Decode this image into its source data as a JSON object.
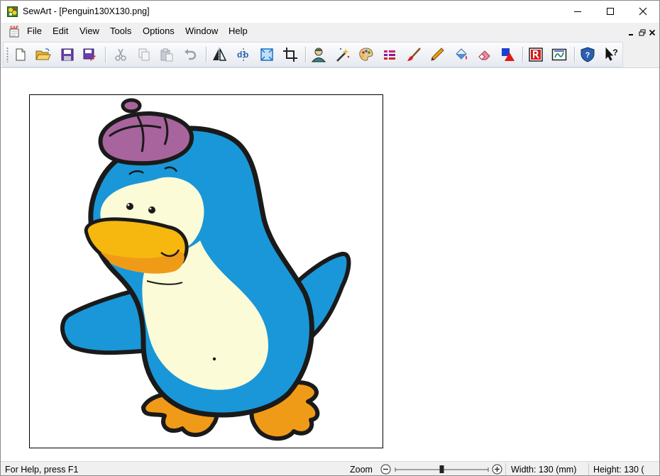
{
  "window": {
    "title": "SewArt - [Penguin130X130.png]",
    "app_icon": "sewart-app-icon",
    "controls": [
      "minimize-icon",
      "maximize-icon",
      "close-icon"
    ]
  },
  "menubar": {
    "items": [
      "File",
      "Edit",
      "View",
      "Tools",
      "Options",
      "Window",
      "Help"
    ],
    "doc_icon_label": "SAF",
    "mdi_controls": [
      "mdi-minimize-icon",
      "mdi-restore-icon",
      "mdi-close-icon"
    ]
  },
  "toolbar": {
    "buttons": [
      "new-file",
      "open-folder",
      "save",
      "save-as",
      "cut",
      "copy",
      "paste",
      "undo",
      "mirror",
      "flip",
      "resize",
      "crop",
      "person",
      "magic-wand",
      "palette",
      "color-list",
      "brush",
      "pencil",
      "fill-bucket",
      "eraser",
      "color-shapes",
      "red-r",
      "convert-to-embroidery",
      "help-shield",
      "context-help"
    ]
  },
  "document": {
    "image_subject": "penguin-image",
    "colors": {
      "blue": "#1a97d8",
      "cream": "#fcfbd8",
      "orange": "#f09b18",
      "beak": "#f6b80f",
      "hat": "#a8649c",
      "outline": "#1a1a1a"
    }
  },
  "statusbar": {
    "help_text": "For Help, press F1",
    "zoom_label": "Zoom",
    "zoom_level": 0.5,
    "width_text": "Width: 130 (mm)",
    "height_text": "Height: 130 ("
  }
}
